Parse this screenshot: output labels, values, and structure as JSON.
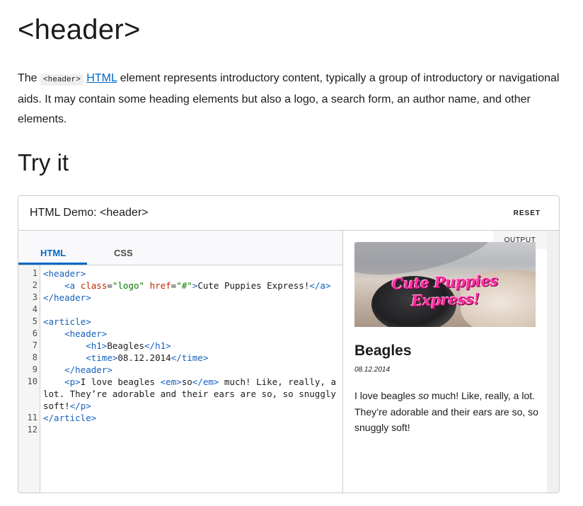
{
  "page": {
    "title": "<header>",
    "intro_pre": "The ",
    "intro_code": "<header>",
    "intro_link": "HTML",
    "intro_post": " element represents introductory content, typically a group of introductory or navigational aids. It may contain some heading elements but also a logo, a search form, an author name, and other elements.",
    "section_heading": "Try it"
  },
  "demo": {
    "title": "HTML Demo: <header>",
    "reset_label": "RESET",
    "tabs": [
      "HTML",
      "CSS"
    ],
    "active_tab": "HTML",
    "output_label": "OUTPUT",
    "code_lines": [
      {
        "n": "1",
        "text": "<header>"
      },
      {
        "n": "2",
        "text": "    <a class=\"logo\" href=\"#\">Cute Puppies Express!</a>"
      },
      {
        "n": "3",
        "text": "</header>"
      },
      {
        "n": "4",
        "text": ""
      },
      {
        "n": "5",
        "text": "<article>"
      },
      {
        "n": "6",
        "text": "    <header>"
      },
      {
        "n": "7",
        "text": "        <h1>Beagles</h1>"
      },
      {
        "n": "8",
        "text": "        <time>08.12.2014</time>"
      },
      {
        "n": "9",
        "text": "    </header>"
      },
      {
        "n": "10",
        "text": "    <p>I love beagles <em>so</em> much! Like, really, a lot. They’re adorable and their ears are so, so snuggly soft!</p>"
      },
      {
        "n": "11",
        "text": "</article>"
      },
      {
        "n": "12",
        "text": ""
      }
    ],
    "output": {
      "logo_text": "Cute Puppies Express!",
      "heading": "Beagles",
      "time": "08.12.2014",
      "p_pre": "I love beagles ",
      "p_em": "so",
      "p_post": " much! Like, really, a lot. They’re adorable and their ears are so, so snuggly soft!"
    }
  },
  "colors": {
    "accent": "#0069c2",
    "logo_pink": "#ff2fa1",
    "tag": "#1560bd",
    "attr": "#bd2900",
    "value": "#0a7a00"
  }
}
